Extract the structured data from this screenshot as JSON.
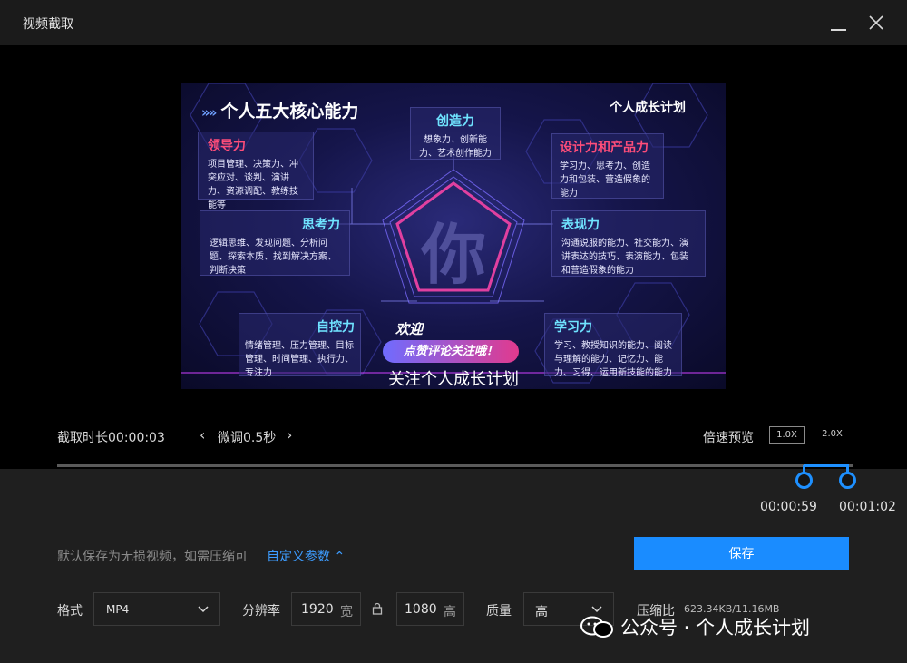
{
  "window": {
    "title": "视频截取"
  },
  "video": {
    "heading": "个人五大核心能力",
    "brand": "个人成长计划",
    "center_char": "你",
    "welcome": "欢迎",
    "cta": "点赞评论关注哦！",
    "subtitle": "关注个人成长计划",
    "cards": [
      {
        "title": "领导力",
        "desc": "项目管理、决策力、冲突应对、谈判、演讲力、资源调配、教练技能等"
      },
      {
        "title": "创造力",
        "desc": "想象力、创新能力、艺术创作能力"
      },
      {
        "title": "设计力和产品力",
        "desc": "学习力、思考力、创造力和包装、营造假象的能力"
      },
      {
        "title": "思考力",
        "desc": "逻辑思维、发现问题、分析问题、探索本质、找到解决方案、判断决策"
      },
      {
        "title": "表现力",
        "desc": "沟通说服的能力、社交能力、演讲表达的技巧、表演能力、包装和营造假象的能力"
      },
      {
        "title": "自控力",
        "desc": "情绪管理、压力管理、目标管理、时间管理、执行力、专注力"
      },
      {
        "title": "学习力",
        "desc": "学习、教授知识的能力、阅读与理解的能力、记忆力、能力、习得、运用新技能的能力"
      }
    ]
  },
  "controls": {
    "clip_duration_label": "截取时长00:00:03",
    "fine_tune_label": "微调0.5秒",
    "speed_preview_label": "倍速预览",
    "speed_options": [
      "1.0X",
      "2.0X"
    ],
    "selected_speed": "1.0X"
  },
  "timeline": {
    "start_time": "00:00:59",
    "end_time": "00:01:02"
  },
  "export": {
    "hint": "默认保存为无损视频，如需压缩可",
    "custom_params_label": "自定义参数",
    "save_label": "保存",
    "format_label": "格式",
    "format_value": "MP4",
    "resolution_label": "分辨率",
    "width_value": "1920",
    "width_unit": "宽",
    "height_value": "1080",
    "height_unit": "高",
    "quality_label": "质量",
    "quality_value": "高",
    "compression_label": "压缩比",
    "compression_value": "623.34KB/11.16MB"
  },
  "watermark": {
    "text": "公众号 · 个人成长计划"
  },
  "colors": {
    "accent": "#1a8cff",
    "pink": "#ff4d7a",
    "cyan": "#6fe3ff"
  }
}
